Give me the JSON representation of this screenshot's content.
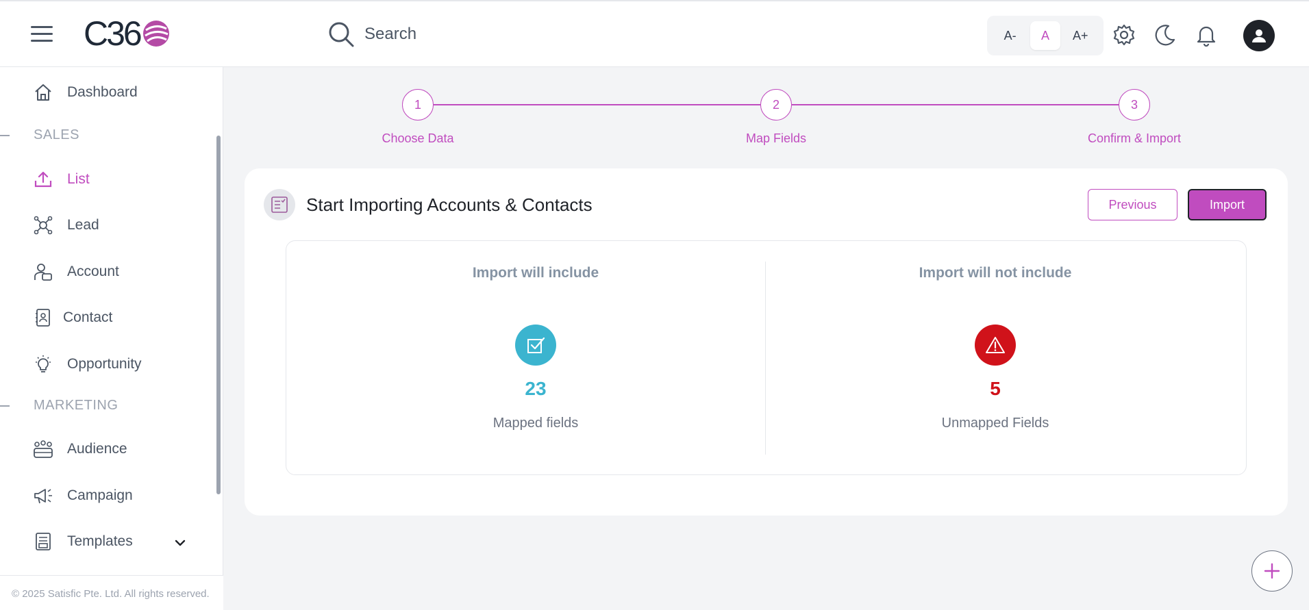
{
  "header": {
    "logo_text": "C36",
    "search_placeholder": "Search",
    "font_sizes": [
      "A-",
      "A",
      "A+"
    ],
    "active_font_size": "A"
  },
  "sidebar": {
    "items": [
      {
        "label": "Dashboard",
        "icon": "home-icon"
      },
      {
        "section": "SALES"
      },
      {
        "label": "List",
        "icon": "upload-icon",
        "active": true
      },
      {
        "label": "Lead",
        "icon": "network-icon"
      },
      {
        "label": "Account",
        "icon": "account-icon"
      },
      {
        "label": "Contact",
        "icon": "contact-card-icon"
      },
      {
        "label": "Opportunity",
        "icon": "lightbulb-icon"
      },
      {
        "section": "MARKETING"
      },
      {
        "label": "Audience",
        "icon": "audience-icon"
      },
      {
        "label": "Campaign",
        "icon": "megaphone-icon"
      },
      {
        "label": "Templates",
        "icon": "template-icon"
      }
    ],
    "sections": {
      "sales": "SALES",
      "marketing": "MARKETING"
    },
    "footer": "© 2025 Satisfic Pte. Ltd. All rights reserved."
  },
  "stepper": {
    "steps": [
      {
        "number": "1",
        "label": "Choose Data"
      },
      {
        "number": "2",
        "label": "Map Fields"
      },
      {
        "number": "3",
        "label": "Confirm & Import"
      }
    ]
  },
  "card": {
    "title": "Start Importing Accounts & Contacts",
    "previous_label": "Previous",
    "import_label": "Import",
    "include": {
      "title": "Import will include",
      "value": "23",
      "label": "Mapped fields",
      "color": "#3bb4cf"
    },
    "exclude": {
      "title": "Import will not include",
      "value": "5",
      "label": "Unmapped Fields",
      "color": "#d0121a"
    }
  },
  "colors": {
    "accent": "#c04cbf",
    "dark": "#1f2228"
  }
}
